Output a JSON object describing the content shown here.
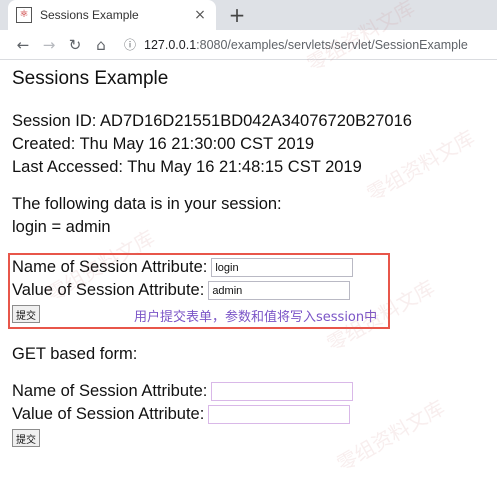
{
  "browser": {
    "tab_title": "Sessions Example",
    "tab_close": "×",
    "new_tab": "+",
    "url_host": "127.0.0.1",
    "url_rest": ":8080/examples/servlets/servlet/SessionExample"
  },
  "page": {
    "heading": "Sessions Example",
    "session_id": "Session ID: AD7D16D21551BD042A34076720B27016",
    "created": "Created: Thu May 16 21:30:00 CST 2019",
    "last_accessed": "Last Accessed: Thu May 16 21:48:15 CST 2019",
    "data_intro": "The following data is in your session:",
    "data_entry": "login = admin",
    "post_form": {
      "name_label": "Name of Session Attribute:",
      "name_value": "login",
      "value_label": "Value of Session Attribute:",
      "value_value": "admin",
      "submit_label": "提交"
    },
    "annotation": "用户提交表单，参数和值将写入session中",
    "get_heading": "GET based form:",
    "get_form": {
      "name_label": "Name of Session Attribute:",
      "name_value": "",
      "value_label": "Value of Session Attribute:",
      "value_value": "",
      "submit_label": "提交"
    }
  },
  "watermark": "零组资料文库"
}
